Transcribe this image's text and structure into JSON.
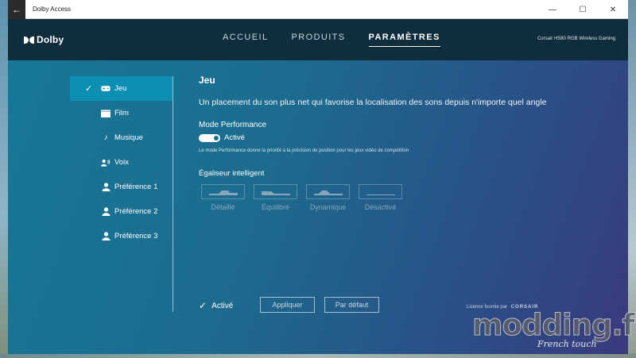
{
  "window": {
    "title": "Dolby Access",
    "back_icon": "←",
    "minimize_icon": "—",
    "maximize_icon": "☐",
    "close_icon": "✕"
  },
  "header": {
    "logo": "Dolby",
    "tabs": [
      "ACCUEIL",
      "PRODUITS",
      "PARAMÈTRES"
    ],
    "active_tab": "PARAMÈTRES",
    "device": "Corsair HS80 RGB Wireless Gaming"
  },
  "sidebar": {
    "items": [
      {
        "label": "Jeu",
        "icon": "gamepad-icon",
        "active": true
      },
      {
        "label": "Film",
        "icon": "clapperboard-icon",
        "active": false
      },
      {
        "label": "Musique",
        "icon": "music-note-icon",
        "active": false
      },
      {
        "label": "Voix",
        "icon": "voice-icon",
        "active": false
      },
      {
        "label": "Préférence 1",
        "icon": "person-icon",
        "active": false
      },
      {
        "label": "Préférence 2",
        "icon": "person-icon",
        "active": false
      },
      {
        "label": "Préférence 3",
        "icon": "person-icon",
        "active": false
      }
    ]
  },
  "content": {
    "title": "Jeu",
    "description": "Un placement du son plus net qui favorise la localisation des sons depuis n'importe quel angle",
    "performance": {
      "title": "Mode Performance",
      "toggle_label": "Activé",
      "toggle_on": true,
      "description": "Le mode Performance donne la priorité à la précision de position pour les jeux vidéo de compétition"
    },
    "equalizer": {
      "title": "Égaliseur intelligent",
      "options": [
        "Détaillé",
        "Équilibré",
        "Dynamique",
        "Désactivé"
      ]
    }
  },
  "footer": {
    "enabled_label": "Activé",
    "apply": "Appliquer",
    "default": "Par défaut",
    "license": "Licence fournie par",
    "license_brand": "CORSAIR"
  },
  "watermark": {
    "main": "modding.fr",
    "sub": "French touch"
  },
  "colors": {
    "header_bg": "#0f2d3c",
    "active_item": "#0d8fb4",
    "content_bg_start": "#187796",
    "content_bg_end": "#3a3a7e"
  }
}
